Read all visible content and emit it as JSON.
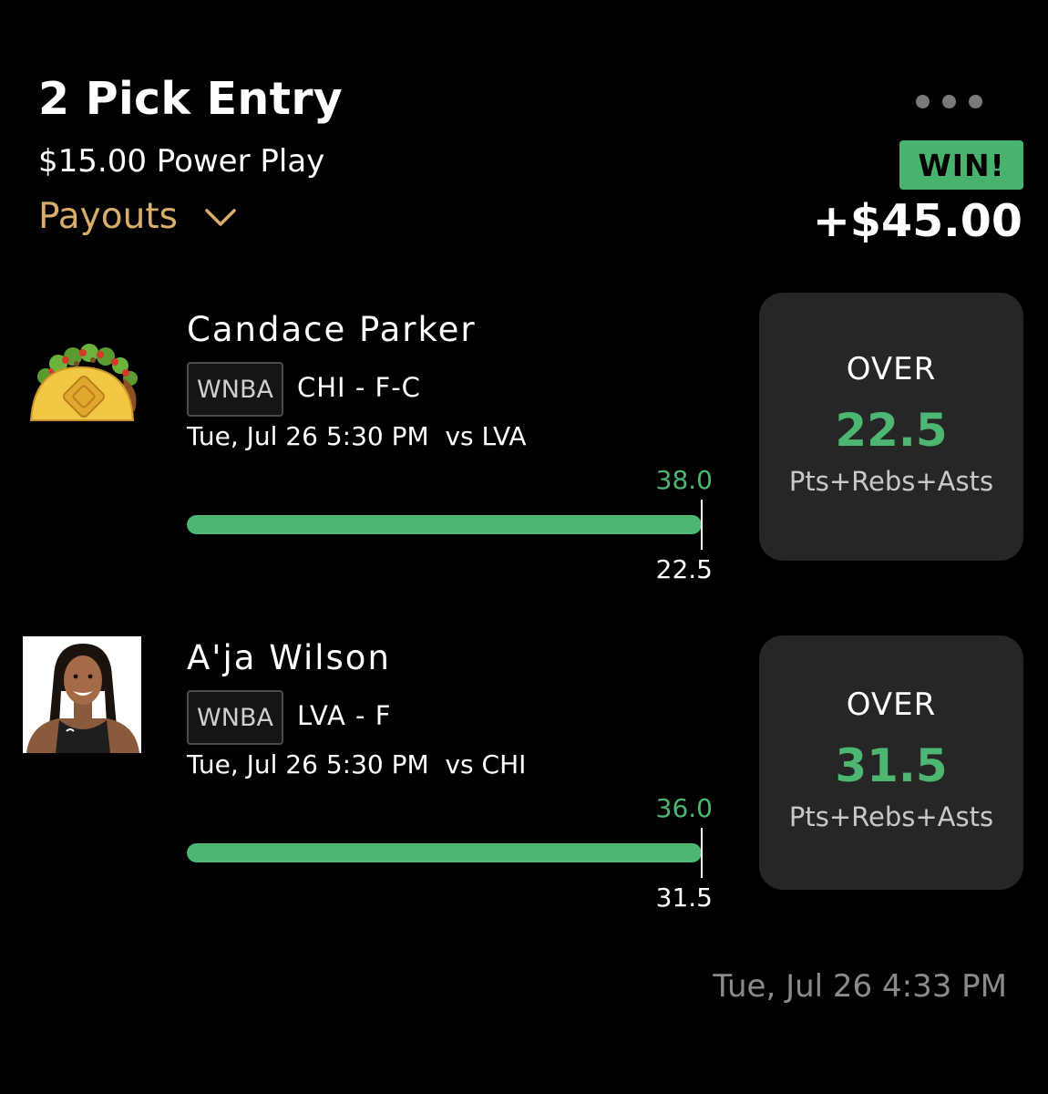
{
  "header": {
    "title": "2 Pick Entry",
    "subtitle": "$15.00 Power Play",
    "payouts_label": "Payouts",
    "status_badge": "WIN!",
    "win_amount": "+$45.00"
  },
  "picks": [
    {
      "player_name": "Candace Parker",
      "avatar_icon": "taco-icon",
      "league": "WNBA",
      "team_position": "CHI - F-C",
      "game_time": "Tue, Jul 26 5:30 PM  vs LVA",
      "actual": "38.0",
      "line": "22.5",
      "direction": "OVER",
      "stat": "Pts+Rebs+Asts"
    },
    {
      "player_name": "A'ja Wilson",
      "avatar_icon": "player-photo",
      "league": "WNBA",
      "team_position": "LVA - F",
      "game_time": "Tue, Jul 26 5:30 PM  vs CHI",
      "actual": "36.0",
      "line": "31.5",
      "direction": "OVER",
      "stat": "Pts+Rebs+Asts"
    }
  ],
  "footer": {
    "timestamp": "Tue, Jul 26 4:33 PM"
  },
  "colors": {
    "background": "#000000",
    "accent_green": "#4db673",
    "badge_green": "#48b26f",
    "payouts_gold": "#d9ad6a",
    "card_bg": "#262626"
  }
}
